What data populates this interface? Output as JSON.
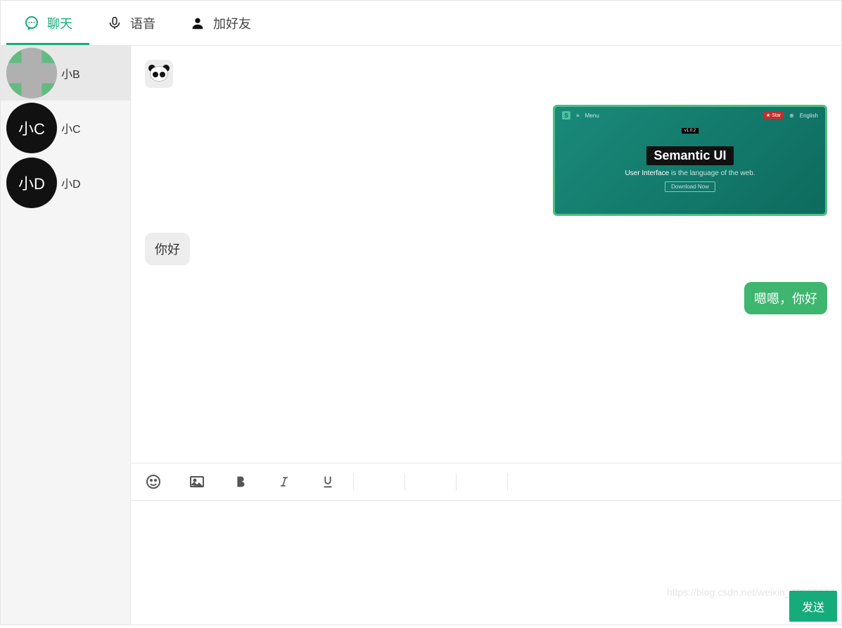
{
  "tabs": [
    {
      "label": "聊天",
      "icon": "chat"
    },
    {
      "label": "语音",
      "icon": "mic"
    },
    {
      "label": "加好友",
      "icon": "person"
    }
  ],
  "contacts": [
    {
      "name": "小B",
      "avatar_text": "",
      "avatar_class": "b"
    },
    {
      "name": "小C",
      "avatar_text": "小C",
      "avatar_class": "c"
    },
    {
      "name": "小D",
      "avatar_text": "小D",
      "avatar_class": "d"
    }
  ],
  "messages": {
    "emoji": "panda",
    "image_card": {
      "title": "Semantic UI",
      "subtitle_prefix": "User Interface",
      "subtitle_rest": " is the language of the web.",
      "button": "Download Now",
      "menu": "Menu",
      "logo_letter": "S",
      "right1": "English",
      "small_tag": "v1.0.2"
    },
    "incoming_text": "你好",
    "outgoing_text": "嗯嗯，你好"
  },
  "toolbar": {
    "tools": [
      "emoji",
      "image",
      "bold",
      "italic",
      "underline"
    ]
  },
  "input": {
    "placeholder": ""
  },
  "send_label": "发送",
  "watermark": "https://blog.csdn.net/weixin_43566977"
}
